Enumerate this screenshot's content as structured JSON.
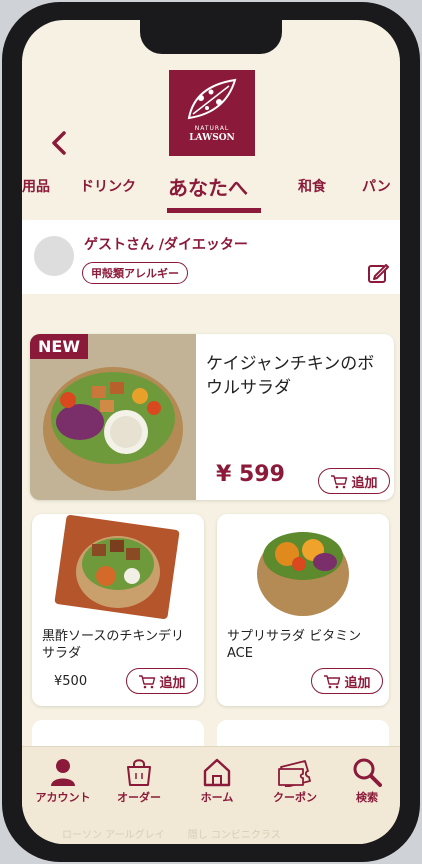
{
  "brand": {
    "line1": "NATURAL",
    "line2": "LAWSON"
  },
  "tabs": [
    "用品",
    "ドリンク",
    "あなたへ",
    "和食",
    "パン"
  ],
  "profile": {
    "name": "ゲストさん /ダイエッター",
    "badge": "甲殻類アレルギー"
  },
  "featured": {
    "tag": "NEW",
    "title": "ケイジャンチキンのボウルサラダ",
    "price": "¥ 599",
    "add_label": "追加"
  },
  "products": [
    {
      "title": "黒酢ソースのチキンデリサラダ",
      "price": "¥500",
      "add_label": "追加"
    },
    {
      "title": "サプリサラダ ビタミンACE",
      "price": "",
      "add_label": "追加"
    }
  ],
  "bottom_nav": [
    {
      "label": "アカウント",
      "icon": "person-icon"
    },
    {
      "label": "オーダー",
      "icon": "shopping-bag-icon"
    },
    {
      "label": "ホーム",
      "icon": "home-icon"
    },
    {
      "label": "クーポン",
      "icon": "coupon-icon"
    },
    {
      "label": "検索",
      "icon": "search-icon"
    }
  ],
  "faint_text": "ローソン アールグレイ  　　隠し  コンビニクラス",
  "colors": {
    "accent": "#8b1a3a",
    "background": "#f6f1e2"
  }
}
